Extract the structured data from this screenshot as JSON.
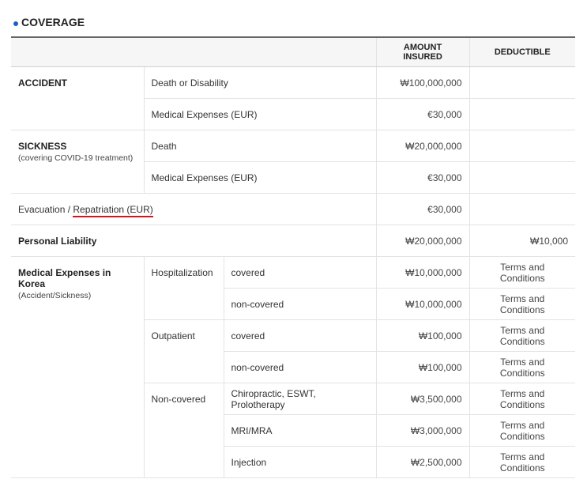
{
  "section": {
    "title": "COVERAGE"
  },
  "headers": {
    "amount": "AMOUNT INSURED",
    "deductible": "DEDUCTIBLE"
  },
  "accident": {
    "label": "ACCIDENT",
    "rows": [
      {
        "item": "Death or Disability",
        "amount": "₩100,000,000",
        "deductible": ""
      },
      {
        "item": "Medical Expenses (EUR)",
        "amount": "€30,000",
        "deductible": ""
      }
    ]
  },
  "sickness": {
    "label": "SICKNESS",
    "note": "(covering COVID-19 treatment)",
    "rows": [
      {
        "item": "Death",
        "amount": "₩20,000,000",
        "deductible": ""
      },
      {
        "item": "Medical Expenses (EUR)",
        "amount": "€30,000",
        "deductible": ""
      }
    ]
  },
  "evacuation": {
    "prefix": "Evacuation / ",
    "highlight": "Repatriation (EUR)",
    "amount": "€30,000",
    "deductible": ""
  },
  "liability": {
    "label": "Personal Liability",
    "amount": "₩20,000,000",
    "deductible": "₩10,000"
  },
  "korea": {
    "label": "Medical Expenses in Korea",
    "note": "(Accident/Sickness)",
    "groups": [
      {
        "name": "Hospitalization",
        "rows": [
          {
            "item": "covered",
            "amount": "₩10,000,000",
            "deductible": "Terms and Conditions"
          },
          {
            "item": "non-covered",
            "amount": "₩10,000,000",
            "deductible": "Terms and Conditions"
          }
        ]
      },
      {
        "name": "Outpatient",
        "rows": [
          {
            "item": "covered",
            "amount": "₩100,000",
            "deductible": "Terms and Conditions"
          },
          {
            "item": "non-covered",
            "amount": "₩100,000",
            "deductible": "Terms and Conditions"
          }
        ]
      },
      {
        "name": "Non-covered",
        "rows": [
          {
            "item": "Chiropractic, ESWT, Prolotherapy",
            "amount": "₩3,500,000",
            "deductible": "Terms and Conditions"
          },
          {
            "item": "MRI/MRA",
            "amount": "₩3,000,000",
            "deductible": "Terms and Conditions"
          },
          {
            "item": "Injection",
            "amount": "₩2,500,000",
            "deductible": "Terms and Conditions"
          }
        ]
      }
    ]
  },
  "colors": {
    "bullet": "#1a5fc8",
    "underline": "#d4141c",
    "header_bg": "#f6f6f6"
  }
}
